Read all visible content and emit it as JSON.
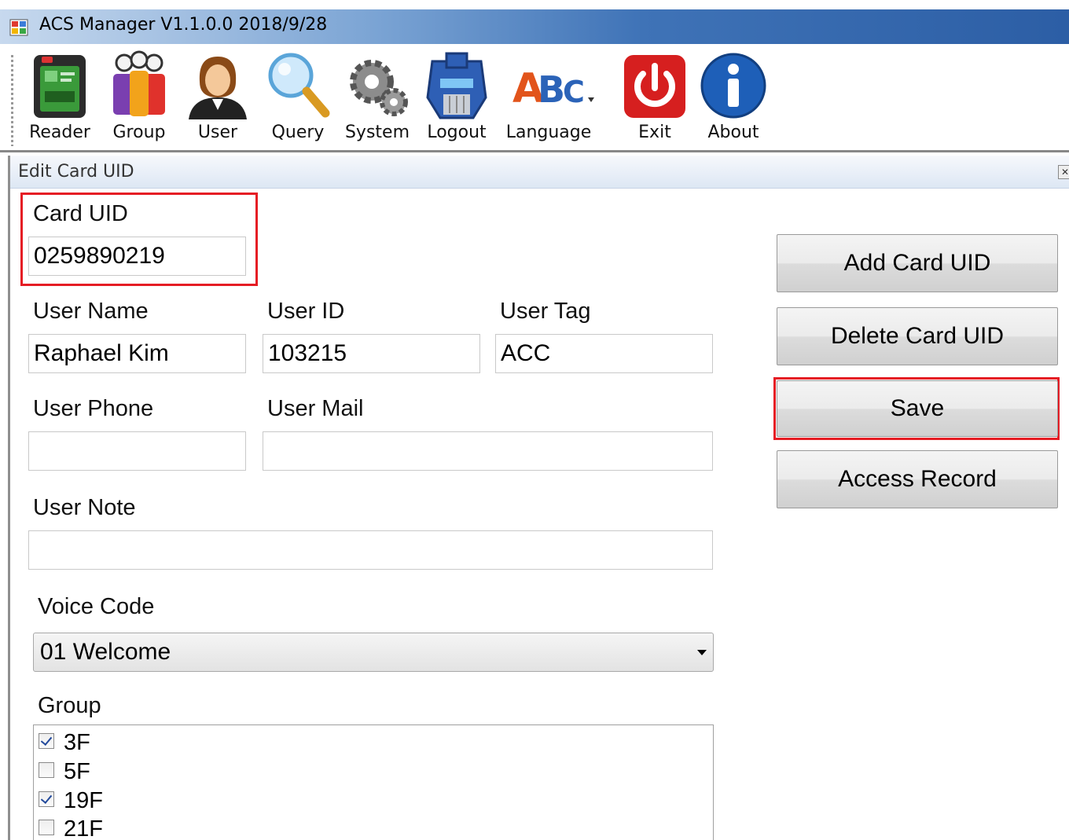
{
  "window": {
    "title": "ACS Manager V1.1.0.0  2018/9/28"
  },
  "toolbar": {
    "items": [
      {
        "label": "Reader",
        "icon": "card-reader-icon"
      },
      {
        "label": "Group",
        "icon": "group-icon"
      },
      {
        "label": "User",
        "icon": "user-icon"
      },
      {
        "label": "Query",
        "icon": "magnifier-icon"
      },
      {
        "label": "System",
        "icon": "gears-icon"
      },
      {
        "label": "Logout",
        "icon": "robot-head-icon"
      },
      {
        "label": "Language",
        "icon": "abc-icon"
      },
      {
        "label": "Exit",
        "icon": "power-icon"
      },
      {
        "label": "About",
        "icon": "info-icon"
      }
    ]
  },
  "panel": {
    "title": "Edit Card UID"
  },
  "form": {
    "card_uid_label": "Card UID",
    "card_uid_value": "0259890219",
    "user_name_label": "User Name",
    "user_name_value": "Raphael Kim",
    "user_id_label": "User ID",
    "user_id_value": "103215",
    "user_tag_label": "User Tag",
    "user_tag_value": "ACC",
    "user_phone_label": "User Phone",
    "user_phone_value": "",
    "user_mail_label": "User Mail",
    "user_mail_value": "",
    "user_note_label": "User Note",
    "user_note_value": "",
    "voice_code_label": "Voice Code",
    "voice_code_value": "01 Welcome",
    "group_label": "Group",
    "groups": [
      {
        "name": "3F",
        "checked": true
      },
      {
        "name": "5F",
        "checked": false
      },
      {
        "name": "19F",
        "checked": true
      },
      {
        "name": "21F",
        "checked": false
      }
    ]
  },
  "actions": {
    "add_label": "Add Card UID",
    "delete_label": "Delete Card UID",
    "save_label": "Save",
    "access_label": "Access Record"
  },
  "colors": {
    "highlight": "#e51c24",
    "titlebar": "#3f73b7"
  }
}
